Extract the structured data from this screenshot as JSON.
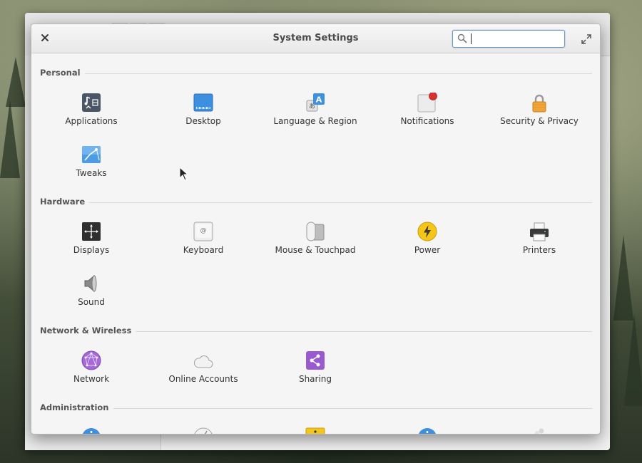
{
  "window": {
    "title": "System Settings",
    "search_placeholder": "",
    "search_value": ""
  },
  "sections": {
    "personal": {
      "label": "Personal",
      "items": [
        {
          "label": "Applications",
          "icon": "applications-icon"
        },
        {
          "label": "Desktop",
          "icon": "desktop-icon"
        },
        {
          "label": "Language & Region",
          "icon": "language-region-icon"
        },
        {
          "label": "Notifications",
          "icon": "notifications-icon"
        },
        {
          "label": "Security & Privacy",
          "icon": "security-privacy-icon"
        },
        {
          "label": "Tweaks",
          "icon": "tweaks-icon"
        }
      ]
    },
    "hardware": {
      "label": "Hardware",
      "items": [
        {
          "label": "Displays",
          "icon": "displays-icon"
        },
        {
          "label": "Keyboard",
          "icon": "keyboard-icon"
        },
        {
          "label": "Mouse & Touchpad",
          "icon": "mouse-touchpad-icon"
        },
        {
          "label": "Power",
          "icon": "power-icon"
        },
        {
          "label": "Printers",
          "icon": "printer-icon"
        },
        {
          "label": "Sound",
          "icon": "sound-icon"
        }
      ]
    },
    "network": {
      "label": "Network & Wireless",
      "items": [
        {
          "label": "Network",
          "icon": "network-icon"
        },
        {
          "label": "Online Accounts",
          "icon": "online-accounts-icon"
        },
        {
          "label": "Sharing",
          "icon": "sharing-icon"
        }
      ]
    },
    "administration": {
      "label": "Administration"
    }
  },
  "colors": {
    "accent_blue": "#3d8fe0",
    "search_border": "#6c98c8",
    "notification_red": "#d93030",
    "power_yellow": "#f5c518",
    "sharing_purple": "#9b59d0"
  }
}
